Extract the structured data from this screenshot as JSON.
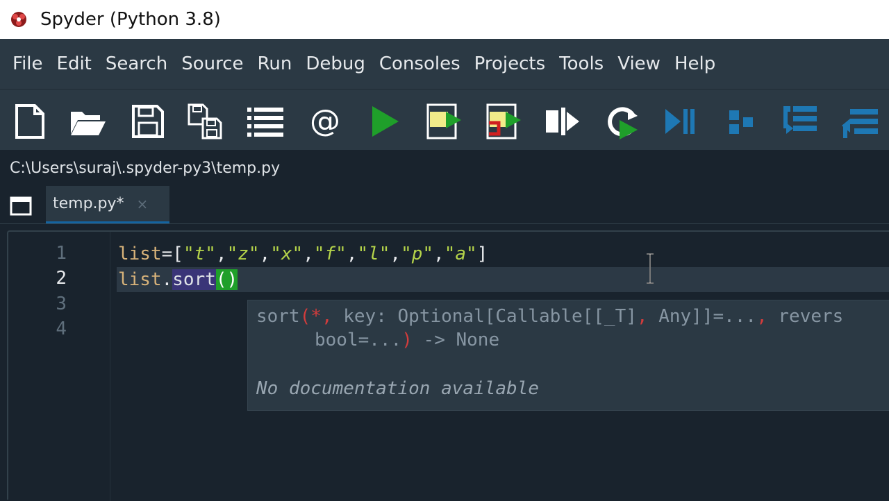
{
  "window": {
    "title": "Spyder (Python 3.8)"
  },
  "menu": {
    "items": [
      "File",
      "Edit",
      "Search",
      "Source",
      "Run",
      "Debug",
      "Consoles",
      "Projects",
      "Tools",
      "View",
      "Help"
    ]
  },
  "toolbar": {
    "icons": [
      "new-file-icon",
      "open-folder-icon",
      "save-icon",
      "save-all-icon",
      "list-icon",
      "at-icon",
      "run-icon",
      "run-cell-icon",
      "run-cell-advance-icon",
      "run-selection-icon",
      "rerun-icon",
      "debug-icon",
      "step-icon",
      "step-into-icon",
      "step-return-icon"
    ]
  },
  "path": {
    "text": "C:\\Users\\suraj\\.spyder-py3\\temp.py"
  },
  "tabs": [
    {
      "label": "temp.py*",
      "close": "×",
      "active": true
    }
  ],
  "editor": {
    "line_numbers": [
      "1",
      "2",
      "3",
      "4"
    ],
    "current_line": 2,
    "line1": {
      "name": "list",
      "eq": "=",
      "open": "[",
      "items": [
        "\"t\"",
        "\"z\"",
        "\"x\"",
        "\"f\"",
        "\"l\"",
        "\"p\"",
        "\"a\""
      ],
      "close": "]"
    },
    "line2": {
      "name": "list",
      "dot": ".",
      "attr": "sort",
      "parens": "()"
    }
  },
  "calltip": {
    "sig_name": "sort",
    "sig_open": "(",
    "sig_star": "*",
    "sig_comma1": ",",
    "sig_key": " key: Optional[Callable[[_T]",
    "sig_comma2": ",",
    "sig_any": " Any]]=...",
    "sig_comma3": ",",
    "sig_reverse": " revers",
    "sig_line2": "bool=...",
    "sig_close": ")",
    "sig_return": " -> None",
    "doc": "No documentation available"
  },
  "colors": {
    "run_green": "#1f9f2a",
    "accent_blue": "#1464a0",
    "string_green": "#b5d44a",
    "name_orange": "#d8b37a"
  }
}
